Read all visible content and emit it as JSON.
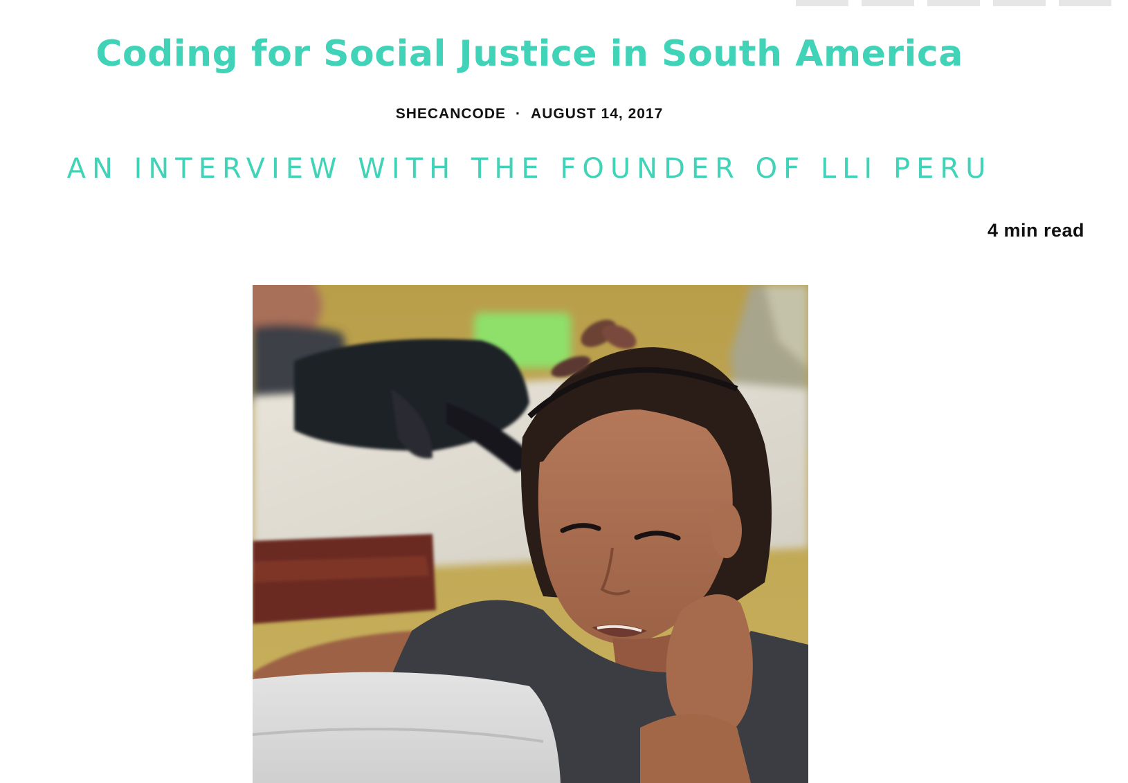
{
  "share_bar": {
    "buttons": [
      "share-button-1",
      "share-button-2",
      "share-button-3",
      "share-button-4",
      "share-button-5"
    ]
  },
  "article": {
    "title": "Coding for Social Justice in South America",
    "author": "SHECANCODE",
    "separator": "·",
    "date": "AUGUST 14, 2017",
    "subtitle": "AN INTERVIEW WITH THE FOUNDER OF LLI PERU",
    "read_time": "4 min read"
  },
  "colors": {
    "accent": "#40d3b8",
    "text": "#111111",
    "share_button": "#e6e6e6"
  }
}
